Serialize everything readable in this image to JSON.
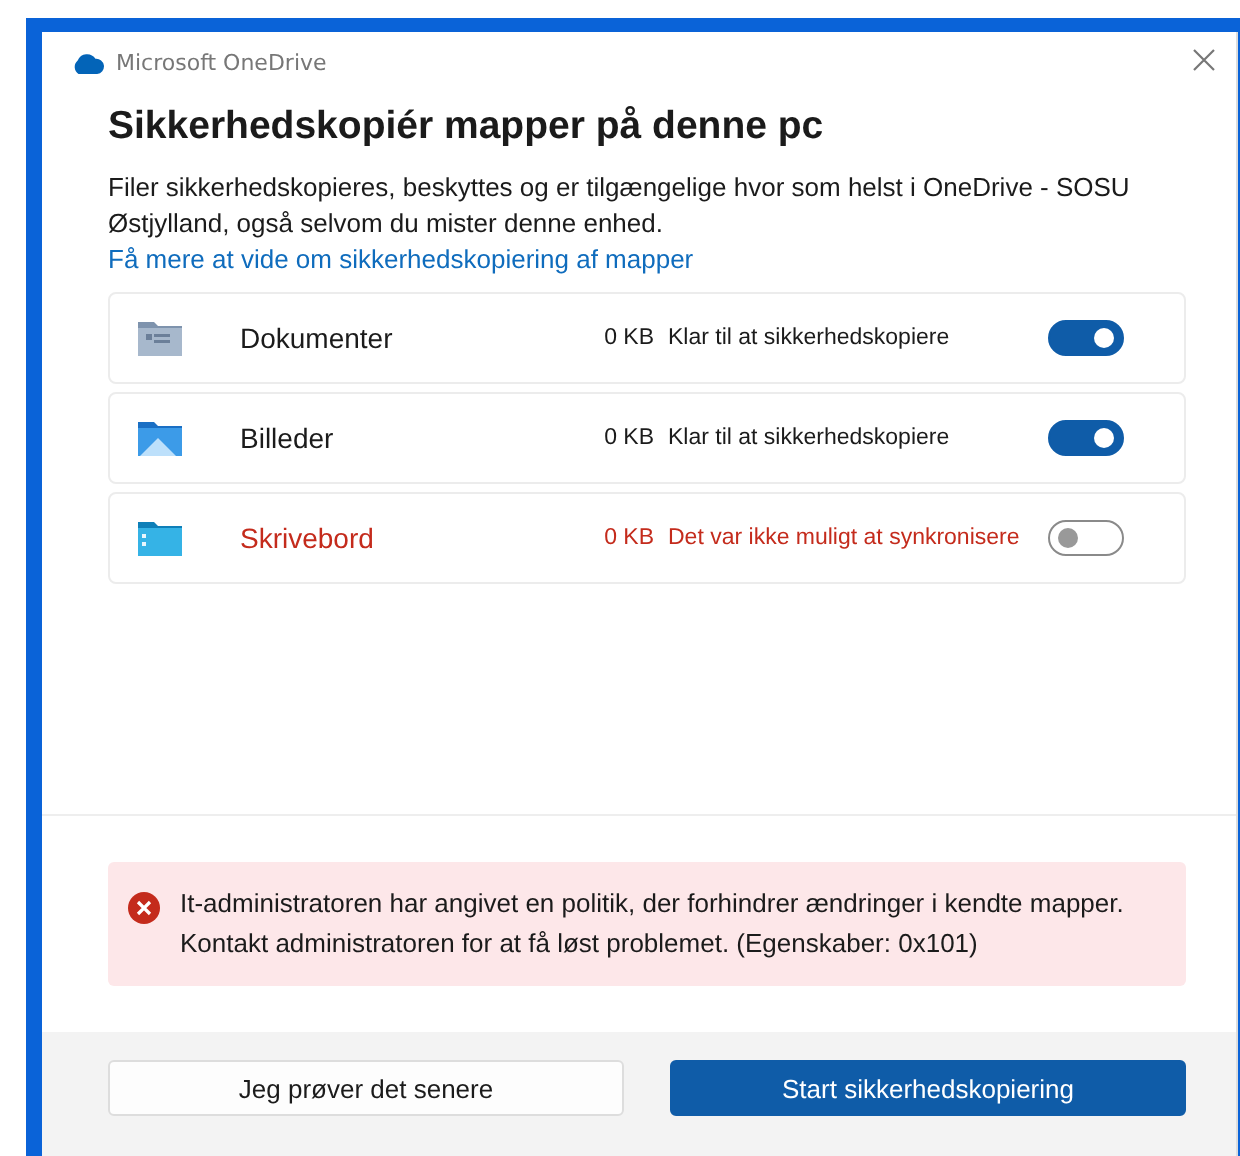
{
  "window": {
    "title": "Microsoft OneDrive"
  },
  "heading": "Sikkerhedskopiér mapper på denne pc",
  "description": "Filer sikkerhedskopieres, beskyttes og er tilgængelige hvor som helst i OneDrive - SOSU Østjylland, også selvom du mister denne enhed.",
  "link": "Få mere at vide om sikkerhedskopiering af mapper",
  "folders": [
    {
      "kind": "documents",
      "name": "Dokumenter",
      "size": "0 KB",
      "status": "Klar til at sikkerhedskopiere",
      "error": false,
      "on": true
    },
    {
      "kind": "pictures",
      "name": "Billeder",
      "size": "0 KB",
      "status": "Klar til at sikkerhedskopiere",
      "error": false,
      "on": true
    },
    {
      "kind": "desktop",
      "name": "Skrivebord",
      "size": "0 KB",
      "status": "Det var ikke muligt at synkronisere",
      "error": true,
      "on": false
    }
  ],
  "error_message": "It-administratoren har angivet en politik, der forhindrer ændringer i kendte mapper. Kontakt administratoren for at få løst problemet. (Egenskaber: 0x101)",
  "buttons": [
    {
      "label": "Jeg prøver det senere",
      "primary": false
    },
    {
      "label": "Start sikkerhedskopiering",
      "primary": true
    }
  ]
}
